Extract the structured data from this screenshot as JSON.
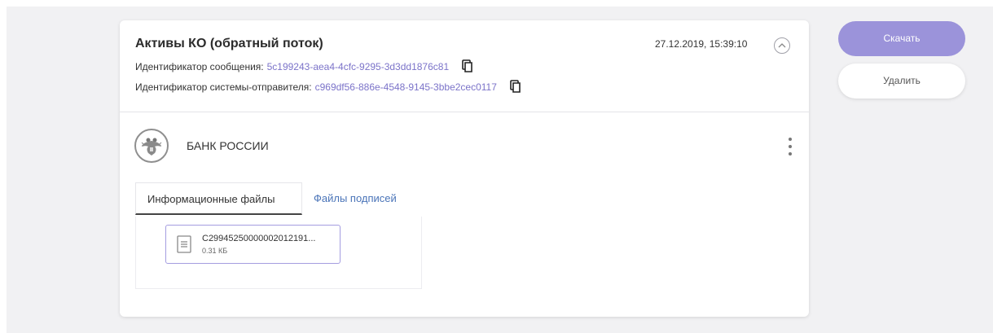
{
  "message": {
    "title": "Активы КО (обратный поток)",
    "timestamp": "27.12.2019, 15:39:10",
    "message_id_label": "Идентификатор сообщения:",
    "message_id_value": "5c199243-aea4-4cfc-9295-3d3dd1876c81",
    "sender_id_label": "Идентификатор системы-отправителя:",
    "sender_id_value": "c969df56-886e-4548-9145-3bbe2cec0117"
  },
  "organization": {
    "name": "БАНК РОССИИ"
  },
  "tabs": [
    {
      "label": "Информационные файлы",
      "active": true
    },
    {
      "label": "Файлы подписей",
      "active": false
    }
  ],
  "files": [
    {
      "name": "C29945250000002012191...",
      "size": "0.31 КБ"
    }
  ],
  "actions": {
    "download_label": "Скачать",
    "delete_label": "Удалить"
  },
  "colors": {
    "accent": "#9b93da",
    "link": "#7b73c9",
    "tab_link": "#4a74b8",
    "background": "#f1f1f3"
  },
  "icons": {
    "copy": "copy-icon",
    "collapse": "chevron-up-icon",
    "menu": "kebab-menu-icon",
    "file": "document-icon",
    "emblem": "bank-emblem-icon"
  }
}
